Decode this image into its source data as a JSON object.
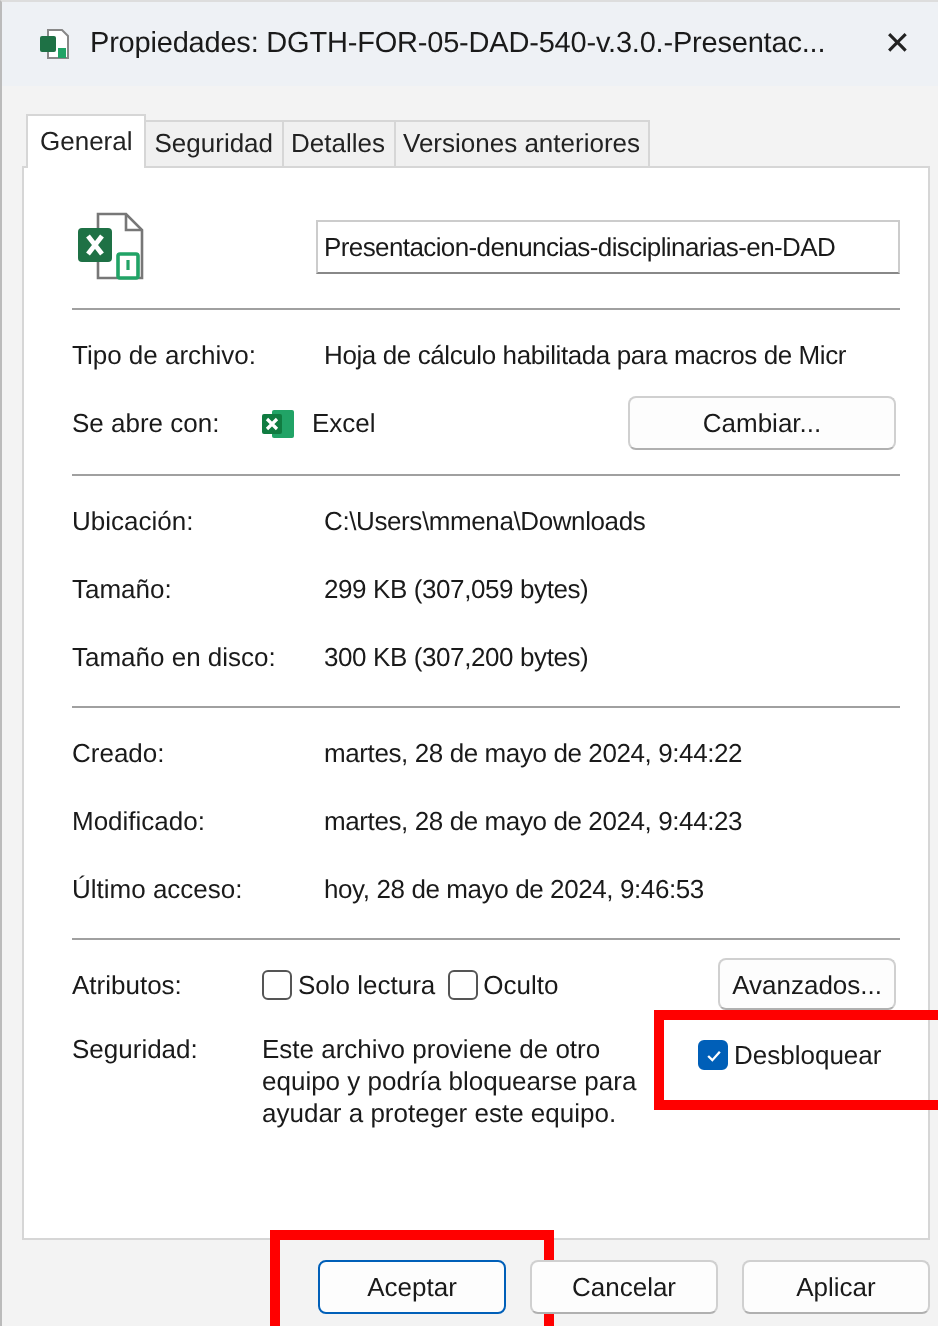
{
  "window": {
    "title": "Propiedades: DGTH-FOR-05-DAD-540-v.3.0.-Presentac...",
    "close": "✕"
  },
  "tabs": [
    {
      "label": "General",
      "selected": true
    },
    {
      "label": "Seguridad",
      "selected": false
    },
    {
      "label": "Detalles",
      "selected": false
    },
    {
      "label": "Versiones anteriores",
      "selected": false
    }
  ],
  "file_name": {
    "value": "Presentacion-denuncias-disciplinarias-en-DAD"
  },
  "sections": [
    [
      {
        "kind": "text",
        "label": "Tipo de archivo:",
        "value": "Hoja de cálculo habilitada para macros de Micr"
      },
      {
        "kind": "app",
        "label": "Se abre con:",
        "value": "Excel",
        "button": "Cambiar..."
      }
    ],
    [
      {
        "kind": "text",
        "label": "Ubicación:",
        "value": "C:\\Users\\mmena\\Downloads"
      },
      {
        "kind": "text",
        "label": "Tamaño:",
        "value": "299 KB (307,059 bytes)"
      },
      {
        "kind": "text",
        "label": "Tamaño en disco:",
        "value": "300 KB (307,200 bytes)"
      }
    ],
    [
      {
        "kind": "text",
        "label": "Creado:",
        "value": "martes, 28 de mayo de 2024, 9:44:22"
      },
      {
        "kind": "text",
        "label": "Modificado:",
        "value": "martes, 28 de mayo de 2024, 9:44:23"
      },
      {
        "kind": "text",
        "label": "Último acceso:",
        "value": "hoy, 28 de mayo de 2024, 9:46:53"
      }
    ]
  ],
  "attributes": {
    "label": "Atributos:",
    "options": [
      {
        "label": "Solo lectura",
        "checked": false
      },
      {
        "label": "Oculto",
        "checked": false
      }
    ],
    "button": "Avanzados..."
  },
  "security": {
    "label": "Seguridad:",
    "text": "Este archivo proviene de otro equipo y podría bloquearse para ayudar a proteger este equipo.",
    "unblock": {
      "label": "Desbloquear",
      "checked": true,
      "highlighted": true
    }
  },
  "buttons": [
    {
      "label": "Aceptar",
      "default": true,
      "highlighted": true
    },
    {
      "label": "Cancelar",
      "default": false,
      "highlighted": false
    },
    {
      "label": "Aplicar",
      "default": false,
      "highlighted": false
    }
  ]
}
